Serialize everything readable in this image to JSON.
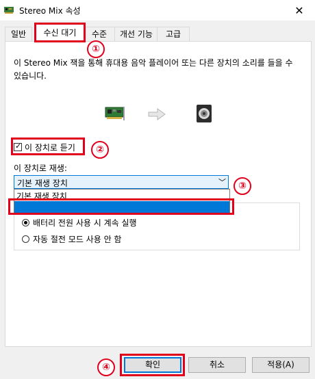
{
  "window": {
    "title": "Stereo Mix 속성"
  },
  "tabs": [
    {
      "label": "일반"
    },
    {
      "label": "수신 대기"
    },
    {
      "label": "수준"
    },
    {
      "label": "개선 기능"
    },
    {
      "label": "고급"
    }
  ],
  "listen_tab": {
    "description": "이 Stereo Mix 잭을 통해 휴대용 음악 플레이어 또는 다른 장치의 소리를 들을 수 있습니다.",
    "listen_checkbox": {
      "label": "이 장치로 듣기",
      "checked": true
    },
    "playback_label": "이 장치로 재생:",
    "playback_dropdown": {
      "selected": "기본 재생 장치",
      "options": [
        "기본 재생 장치"
      ]
    },
    "power_options": [
      {
        "label": "배터리 전원 사용 시 계속 실행",
        "selected": true
      },
      {
        "label": "자동 절전 모드 사용 안 함",
        "selected": false
      }
    ]
  },
  "buttons": {
    "ok": "확인",
    "cancel": "취소",
    "apply": "적용(A)"
  },
  "annotations": [
    "①",
    "②",
    "③",
    "④"
  ],
  "colors": {
    "annotation": "#e0001b",
    "selection": "#0078d7"
  }
}
